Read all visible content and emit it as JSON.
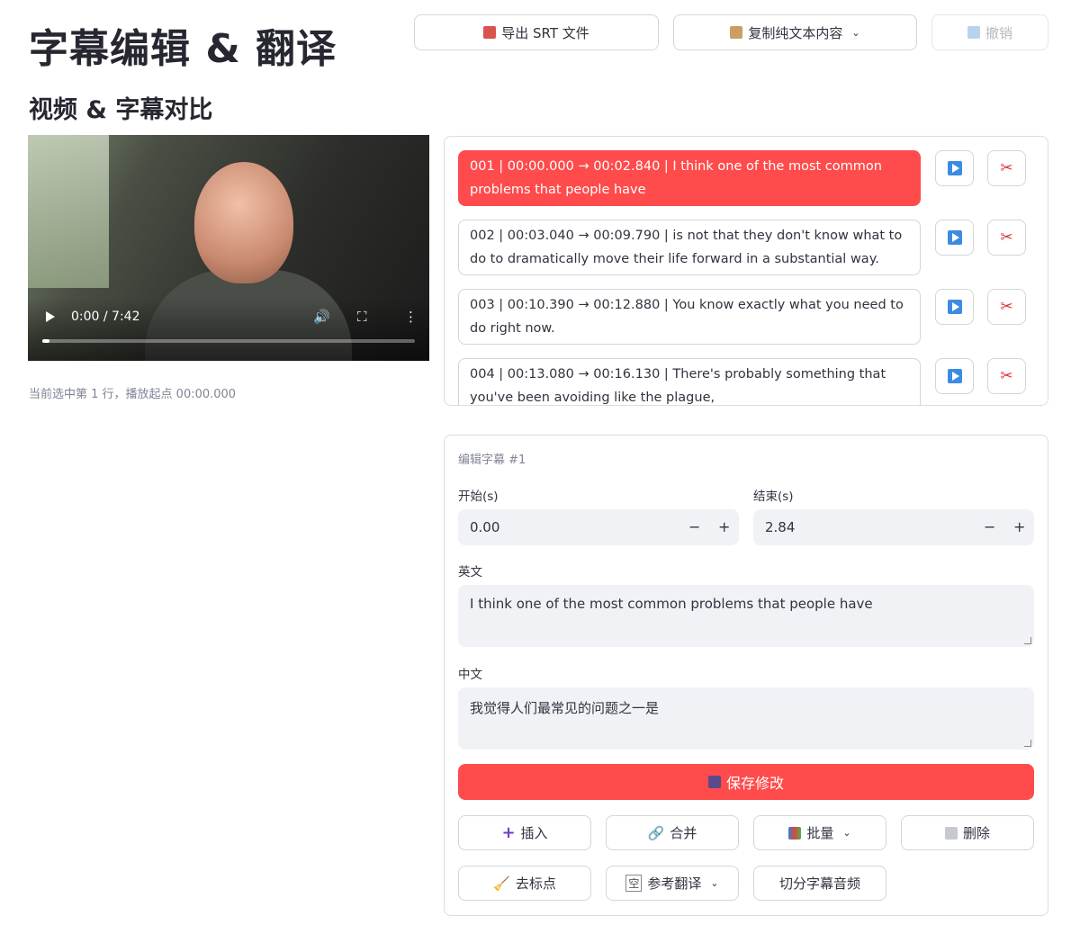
{
  "header": {
    "title": "字幕编辑 & 翻译",
    "export_label": "导出 SRT 文件",
    "copy_label": "复制纯文本内容",
    "undo_label": "撤销"
  },
  "section": {
    "title": "视频 & 字幕对比"
  },
  "video": {
    "time": "0:00 / 7:42",
    "progress": 0.02
  },
  "status": {
    "text": "当前选中第 1 行，播放起点 00:00.000"
  },
  "subtitles": [
    {
      "text": "001 | 00:00.000 → 00:02.840 | I think one of the most common problems that people have",
      "active": true
    },
    {
      "text": "002 | 00:03.040 → 00:09.790 | is not that they don't know what to do to dramatically move their life forward in a substantial way.",
      "active": false
    },
    {
      "text": "003 | 00:10.390 → 00:12.880 | You know exactly what you need to do right now.",
      "active": false
    },
    {
      "text": "004 | 00:13.080 → 00:16.130 | There's probably something that you've been avoiding like the plague,",
      "active": false
    }
  ],
  "editor": {
    "heading": "编辑字幕 #1",
    "start_label": "开始(s)",
    "start_value": "0.00",
    "end_label": "结束(s)",
    "end_value": "2.84",
    "minus": "−",
    "plus": "+",
    "en_label": "英文",
    "en_value": "I think one of the most common problems that people have",
    "zh_label": "中文",
    "zh_value": "我觉得人们最常见的问题之一是",
    "save_label": "保存修改"
  },
  "actions": {
    "insert": "插入",
    "merge": "合并",
    "batch": "批量",
    "delete": "删除",
    "strip_punct": "去标点",
    "ref_translate": "参考翻译",
    "split_audio": "切分字幕音频"
  },
  "colors": {
    "accent": "#ff4b4b",
    "border": "#d4d5da",
    "input_bg": "#f0f2f6"
  }
}
